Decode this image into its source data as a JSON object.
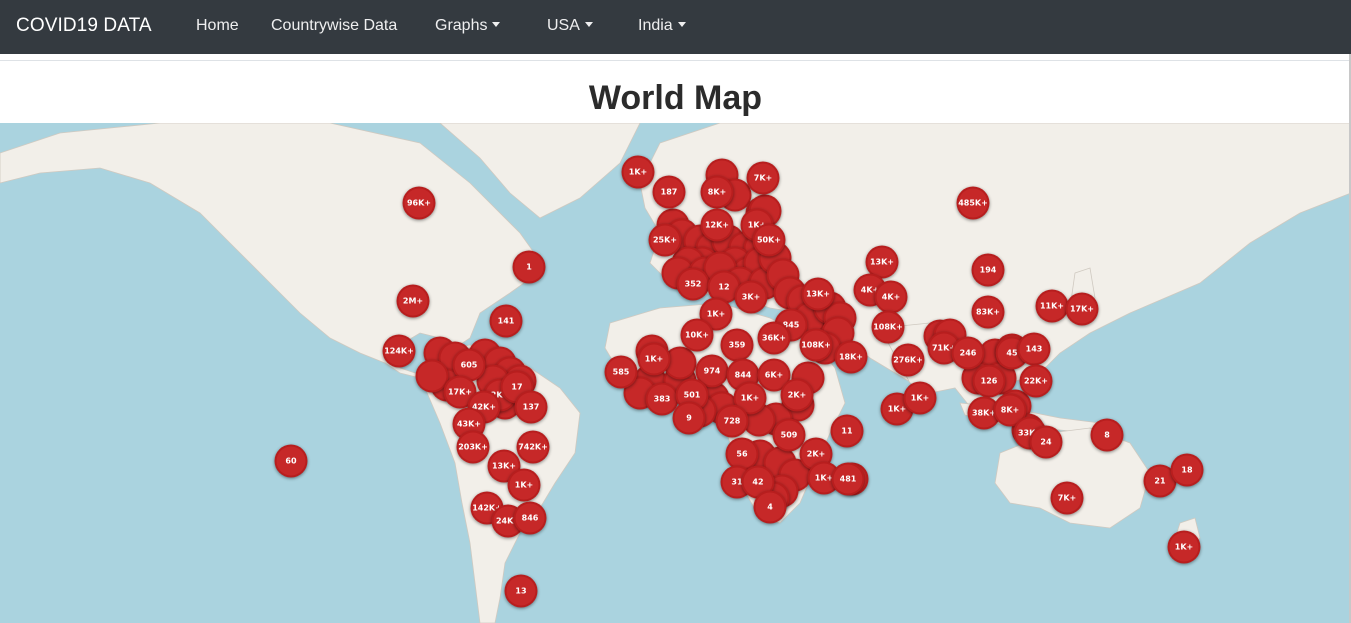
{
  "navbar": {
    "brand": "COVID19 DATA",
    "links": [
      {
        "label": "Home"
      },
      {
        "label": "Countrywise Data"
      },
      {
        "label": "Graphs"
      },
      {
        "label": "USA"
      },
      {
        "label": "India"
      }
    ]
  },
  "page": {
    "title": "World Map"
  },
  "colors": {
    "navbar_bg": "#343a40",
    "marker": "#c62828",
    "water": "#aad3df",
    "land": "#f2efe9"
  },
  "map": {
    "markers": [
      {
        "label": "96K+"
      },
      {
        "label": "2M+"
      },
      {
        "label": "1"
      },
      {
        "label": "141"
      },
      {
        "label": "124K+"
      },
      {
        "label": "605"
      },
      {
        "label": "17K+"
      },
      {
        "label": "2K+"
      },
      {
        "label": "17"
      },
      {
        "label": "42K+"
      },
      {
        "label": "137"
      },
      {
        "label": "43K+"
      },
      {
        "label": "203K+"
      },
      {
        "label": "742K+"
      },
      {
        "label": "13K+"
      },
      {
        "label": "1K+"
      },
      {
        "label": "142K+"
      },
      {
        "label": "24K+"
      },
      {
        "label": "846"
      },
      {
        "label": "13"
      },
      {
        "label": "60"
      },
      {
        "label": "1K+"
      },
      {
        "label": "187"
      },
      {
        "label": "8K+"
      },
      {
        "label": "7K+"
      },
      {
        "label": "12K+"
      },
      {
        "label": "1K+"
      },
      {
        "label": "25K+"
      },
      {
        "label": "50K+"
      },
      {
        "label": "352"
      },
      {
        "label": "12"
      },
      {
        "label": "3K+"
      },
      {
        "label": "13K+"
      },
      {
        "label": "1K+"
      },
      {
        "label": "10K+"
      },
      {
        "label": "845"
      },
      {
        "label": "36K+"
      },
      {
        "label": "359"
      },
      {
        "label": "108K+"
      },
      {
        "label": "18K+"
      },
      {
        "label": "585"
      },
      {
        "label": "1K+"
      },
      {
        "label": "974"
      },
      {
        "label": "844"
      },
      {
        "label": "6K+"
      },
      {
        "label": "383"
      },
      {
        "label": "501"
      },
      {
        "label": "1K+"
      },
      {
        "label": "2K+"
      },
      {
        "label": "9"
      },
      {
        "label": "728"
      },
      {
        "label": "509"
      },
      {
        "label": "11"
      },
      {
        "label": "56"
      },
      {
        "label": "2K+"
      },
      {
        "label": "1K+"
      },
      {
        "label": "481"
      },
      {
        "label": "31"
      },
      {
        "label": "42"
      },
      {
        "label": "4"
      },
      {
        "label": "485K+"
      },
      {
        "label": "13K+"
      },
      {
        "label": "194"
      },
      {
        "label": "4K+"
      },
      {
        "label": "4K+"
      },
      {
        "label": "108K+"
      },
      {
        "label": "83K+"
      },
      {
        "label": "11K+"
      },
      {
        "label": "17K+"
      },
      {
        "label": "276K+"
      },
      {
        "label": "71K+"
      },
      {
        "label": "246"
      },
      {
        "label": "45"
      },
      {
        "label": "143"
      },
      {
        "label": "126"
      },
      {
        "label": "22K+"
      },
      {
        "label": "1K+"
      },
      {
        "label": "1K+"
      },
      {
        "label": "38K+"
      },
      {
        "label": "8K+"
      },
      {
        "label": "33K+"
      },
      {
        "label": "24"
      },
      {
        "label": "8"
      },
      {
        "label": "7K+"
      },
      {
        "label": "21"
      },
      {
        "label": "18"
      },
      {
        "label": "1K+"
      }
    ]
  }
}
